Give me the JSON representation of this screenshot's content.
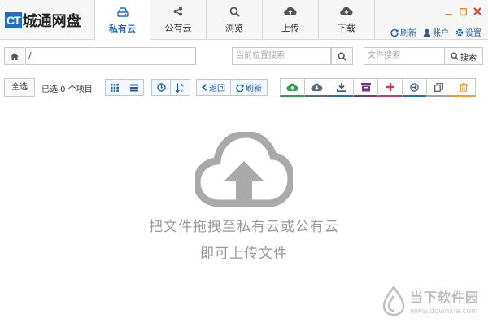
{
  "app": {
    "logo_badge": "CT",
    "logo_text": "城通网盘"
  },
  "tabs": [
    {
      "label": "私有云",
      "icon": "drive-icon",
      "active": true
    },
    {
      "label": "公有云",
      "icon": "share-icon",
      "active": false
    },
    {
      "label": "浏览",
      "icon": "search-icon",
      "active": false
    },
    {
      "label": "上传",
      "icon": "cloud-upload-icon",
      "active": false
    },
    {
      "label": "下载",
      "icon": "cloud-download-icon",
      "active": false
    }
  ],
  "window_controls": [
    "minimize",
    "maximize",
    "close"
  ],
  "top_actions": {
    "refresh": "刷新",
    "account": "账户",
    "settings": "设置"
  },
  "path_bar": {
    "path": "/",
    "location_search_placeholder": "当前位置搜索",
    "file_search_placeholder": "文件搜索",
    "search_button": "搜索"
  },
  "toolbar": {
    "select_all": "全选",
    "selection_info": "已选 0 个项目",
    "back": "返回",
    "refresh": "刷新"
  },
  "dropzone": {
    "line1": "把文件拖拽至私有云或公有云",
    "line2": "即可上传文件"
  },
  "watermark": {
    "cn": "当下软件园",
    "en": "www.downxia.com"
  },
  "colors": {
    "accent": "#1f6fc7",
    "upload_green": "#2f9e4a",
    "delete_orange": "#f39a2b",
    "add_red": "#c23a6a",
    "archive_purple": "#6b3a8a",
    "cloud_gray": "#aaaaaa"
  }
}
